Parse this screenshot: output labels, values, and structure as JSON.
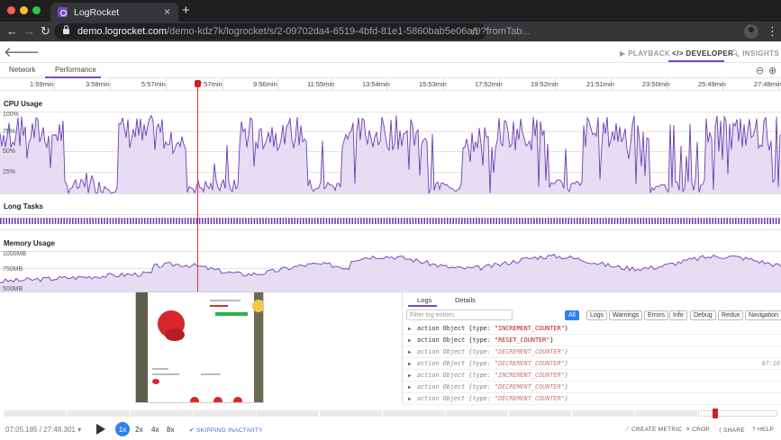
{
  "browser": {
    "tab_title": "LogRocket",
    "url_host": "demo.logrocket.com",
    "url_path": "/demo-kdz7k/logrocket/s/2-09702da4-6519-4bfd-81e1-5860bab5e06a/0?fromTab..."
  },
  "header": {
    "modes": [
      "PLAYBACK",
      "DEVELOPER",
      "INSIGHTS"
    ],
    "active_mode": "DEVELOPER"
  },
  "subtabs": [
    "Network",
    "Performance"
  ],
  "active_subtab": "Performance",
  "timeline": {
    "ticks": [
      "1:59min",
      "3:58min",
      "5:57min",
      "7:57min",
      "9:56min",
      "11:55min",
      "13:54min",
      "15:53min",
      "17:52min",
      "19:52min",
      "21:51min",
      "23:50min",
      "25:49min",
      "27:48min"
    ],
    "cpu": {
      "label": "CPU Usage",
      "axis": [
        "100%",
        "75%",
        "50%",
        "25%"
      ]
    },
    "long_tasks": {
      "label": "Long Tasks"
    },
    "memory": {
      "label": "Memory Usage",
      "axis": [
        "1000MB",
        "750MB",
        "500MB"
      ]
    }
  },
  "console": {
    "tabs": [
      "Logs",
      "Details"
    ],
    "filter_placeholder": "Filter log entries",
    "levels": [
      "All",
      "Logs",
      "Warnings",
      "Errors",
      "Info",
      "Debug",
      "Redux",
      "Navigation"
    ],
    "active_level": "All",
    "rows": [
      {
        "prefix": "action Object {type: ",
        "value": "\"INCREMENT_COUNTER\"",
        "suffix": "}",
        "dim": false,
        "time": ""
      },
      {
        "prefix": "action Object {type: ",
        "value": "\"RESET_COUNTER\"",
        "suffix": "}",
        "dim": false,
        "time": ""
      },
      {
        "prefix": "action Object {type: ",
        "value": "\"DECREMENT_COUNTER\"",
        "suffix": "}",
        "dim": true,
        "time": ""
      },
      {
        "prefix": "action Object {type: ",
        "value": "\"DECREMENT_COUNTER\"",
        "suffix": "}",
        "dim": true,
        "time": "07:16"
      },
      {
        "prefix": "action Object {type: ",
        "value": "\"INCREMENT_COUNTER\"",
        "suffix": "}",
        "dim": true,
        "time": ""
      },
      {
        "prefix": "action Object {type: ",
        "value": "\"DECREMENT_COUNTER\"",
        "suffix": "}",
        "dim": true,
        "time": ""
      },
      {
        "prefix": "action Object {type: ",
        "value": "\"DECREMENT_COUNTER\"",
        "suffix": "}",
        "dim": true,
        "time": ""
      }
    ]
  },
  "player": {
    "time": "07:05.185 / 27:48.301",
    "speeds": [
      "1x",
      "2x",
      "4x",
      "8x"
    ],
    "active_speed": "1x",
    "skip_label": "SKIPPING INACTIVITY",
    "actions": [
      "CREATE METRIC",
      "CROP",
      "SHARE",
      "HELP"
    ]
  },
  "colors": {
    "accent": "#764abc",
    "chart_fill": "#e6dcf3",
    "chart_line": "#6a3fb5",
    "playhead": "#dd3333",
    "blue": "#2f80ed"
  },
  "icons": {
    "back": "arrow-left-icon",
    "forward": "arrow-right-icon",
    "reload": "reload-icon",
    "lock": "lock-icon",
    "star": "star-icon",
    "playback": "play-icon",
    "developer": "code-icon",
    "insights": "search-icon",
    "zoom_out": "zoom-out-icon",
    "zoom_in": "zoom-in-icon"
  }
}
